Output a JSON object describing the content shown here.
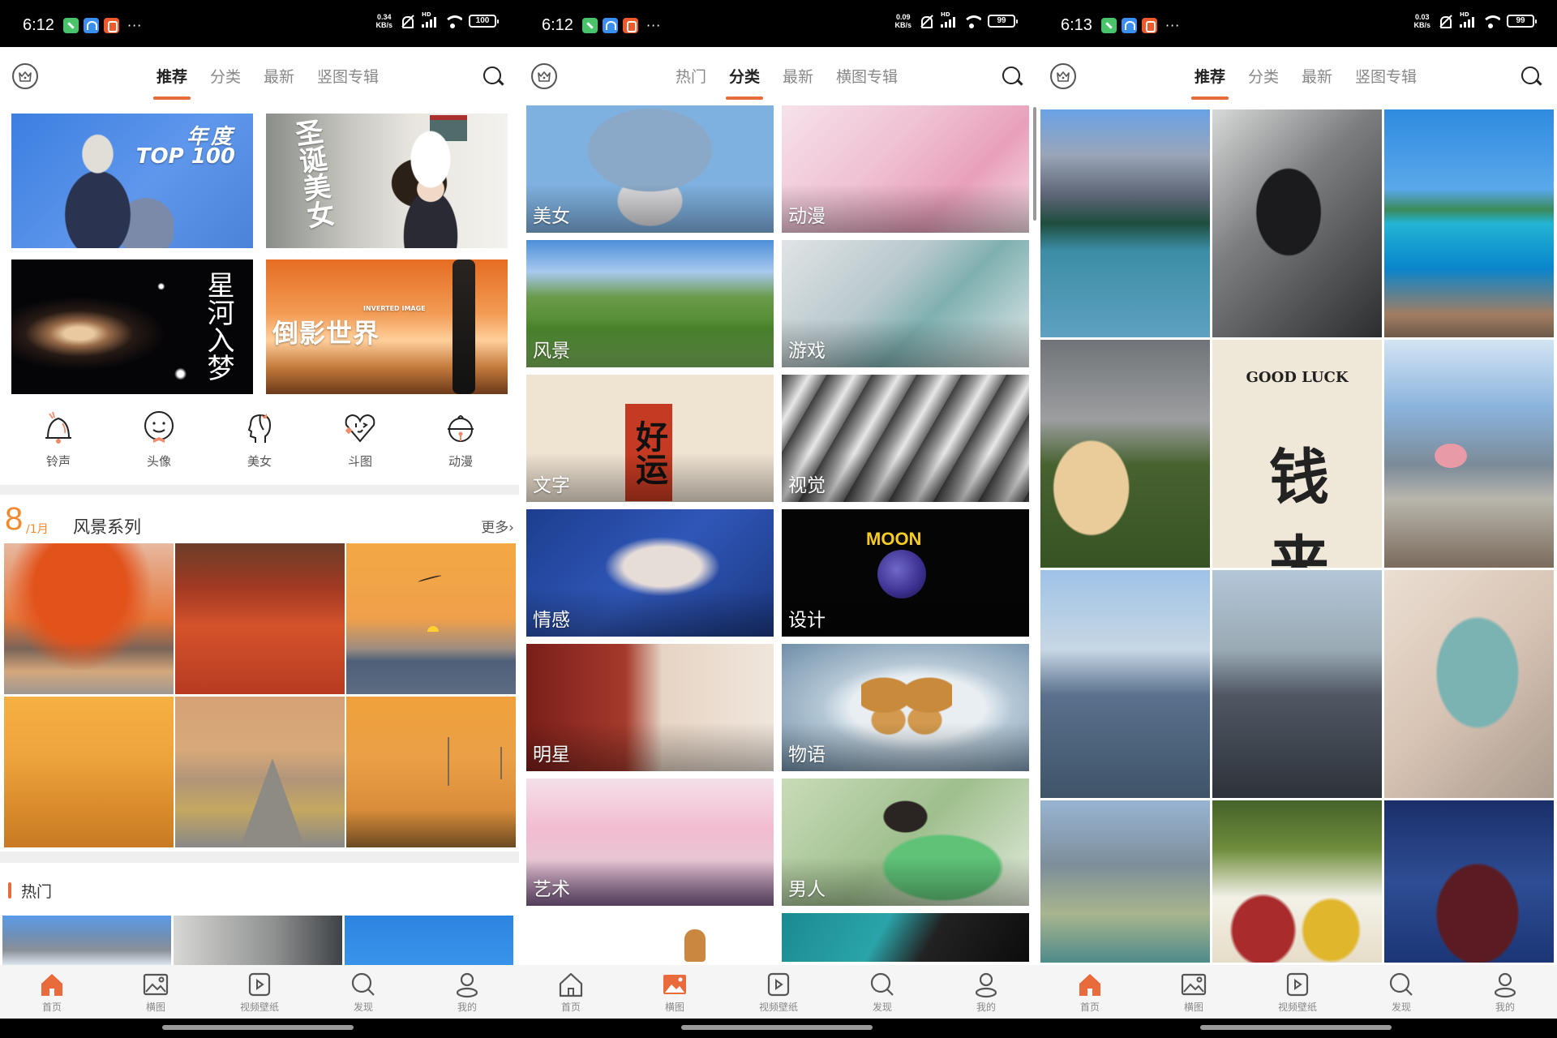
{
  "screens": [
    {
      "status": {
        "time": "6:12",
        "net_speed": "0.34",
        "net_unit": "KB/s",
        "signal_tag": "HD",
        "wifi_tag": "6",
        "battery": "100"
      },
      "topbar": {
        "tabs": [
          "推荐",
          "分类",
          "最新",
          "竖图专辑"
        ],
        "active_tab": 0
      },
      "banners": [
        {
          "title": "年度",
          "badge": "hot",
          "subtitle": "TOP 100"
        },
        {
          "title": "圣诞美女"
        },
        {
          "title": "星河入梦"
        },
        {
          "title": "倒影世界",
          "subtitle": "INVERTED IMAGE"
        }
      ],
      "quick_links": [
        {
          "icon": "bell-icon",
          "label": "铃声"
        },
        {
          "icon": "smiley-icon",
          "label": "头像"
        },
        {
          "icon": "girl-profile-icon",
          "label": "美女"
        },
        {
          "icon": "wink-heart-icon",
          "label": "斗图"
        },
        {
          "icon": "jingle-bell-icon",
          "label": "动漫"
        }
      ],
      "series": {
        "day": "8",
        "month": "/1月",
        "title": "风景系列",
        "more": "更多›",
        "thumbnails": 6
      },
      "hot": {
        "title": "热门",
        "thumbnails": 3
      },
      "bottom_nav": {
        "items": [
          "首页",
          "横图",
          "视频壁纸",
          "发现",
          "我的"
        ],
        "active": 0
      }
    },
    {
      "status": {
        "time": "6:12",
        "net_speed": "0.09",
        "net_unit": "KB/s",
        "signal_tag": "HD",
        "wifi_tag": "6",
        "battery": "99"
      },
      "topbar": {
        "tabs": [
          "热门",
          "分类",
          "最新",
          "横图专辑"
        ],
        "active_tab": 1
      },
      "categories": [
        "美女",
        "动漫",
        "风景",
        "游戏",
        "文字",
        "视觉",
        "情感",
        "设计",
        "明星",
        "物语",
        "艺术",
        "男人"
      ],
      "category_art_text": {
        "wenzi": "好运",
        "sheji": "MOON"
      },
      "bottom_nav": {
        "items": [
          "首页",
          "横图",
          "视频壁纸",
          "发现",
          "我的"
        ],
        "active": 1
      }
    },
    {
      "status": {
        "time": "6:13",
        "net_speed": "0.03",
        "net_unit": "KB/s",
        "signal_tag": "HD",
        "wifi_tag": "6",
        "battery": "99"
      },
      "topbar": {
        "tabs": [
          "推荐",
          "分类",
          "最新",
          "竖图专辑"
        ],
        "active_tab": 0
      },
      "wallpaper_art_text": {
        "good_luck": "GOOD LUCK",
        "qian": "钱来"
      },
      "bottom_nav": {
        "items": [
          "首页",
          "横图",
          "视频壁纸",
          "发现",
          "我的"
        ],
        "active": 0
      }
    }
  ],
  "colors": {
    "accent": "#e96b3c",
    "series_number": "#f08a2e",
    "inactive_tab": "#888888",
    "nav_bg": "#f5f5f5"
  }
}
